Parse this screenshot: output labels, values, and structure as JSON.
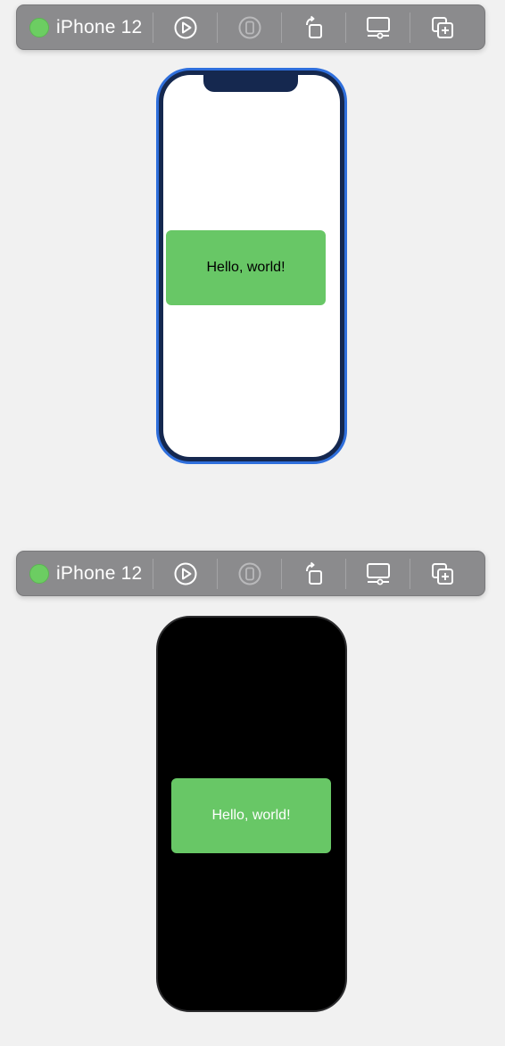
{
  "previews": [
    {
      "device_name": "iPhone 12",
      "status": "green-dot",
      "color_scheme": "light",
      "content_text": "Hello, world!",
      "toolbar_icons": [
        "live-preview-icon",
        "device-icon",
        "rotate-device-icon",
        "device-settings-icon",
        "duplicate-preview-icon"
      ]
    },
    {
      "device_name": "iPhone 12",
      "status": "green-dot",
      "color_scheme": "dark",
      "content_text": "Hello, world!",
      "toolbar_icons": [
        "live-preview-icon",
        "device-icon",
        "rotate-device-icon",
        "device-settings-icon",
        "duplicate-preview-icon"
      ]
    }
  ],
  "colors": {
    "background": "#f1f1f1",
    "toolbar": "#8b8b8d",
    "status_dot": "#6ccd62",
    "card_green": "#68c766",
    "selection_border": "#2f6fdc"
  }
}
